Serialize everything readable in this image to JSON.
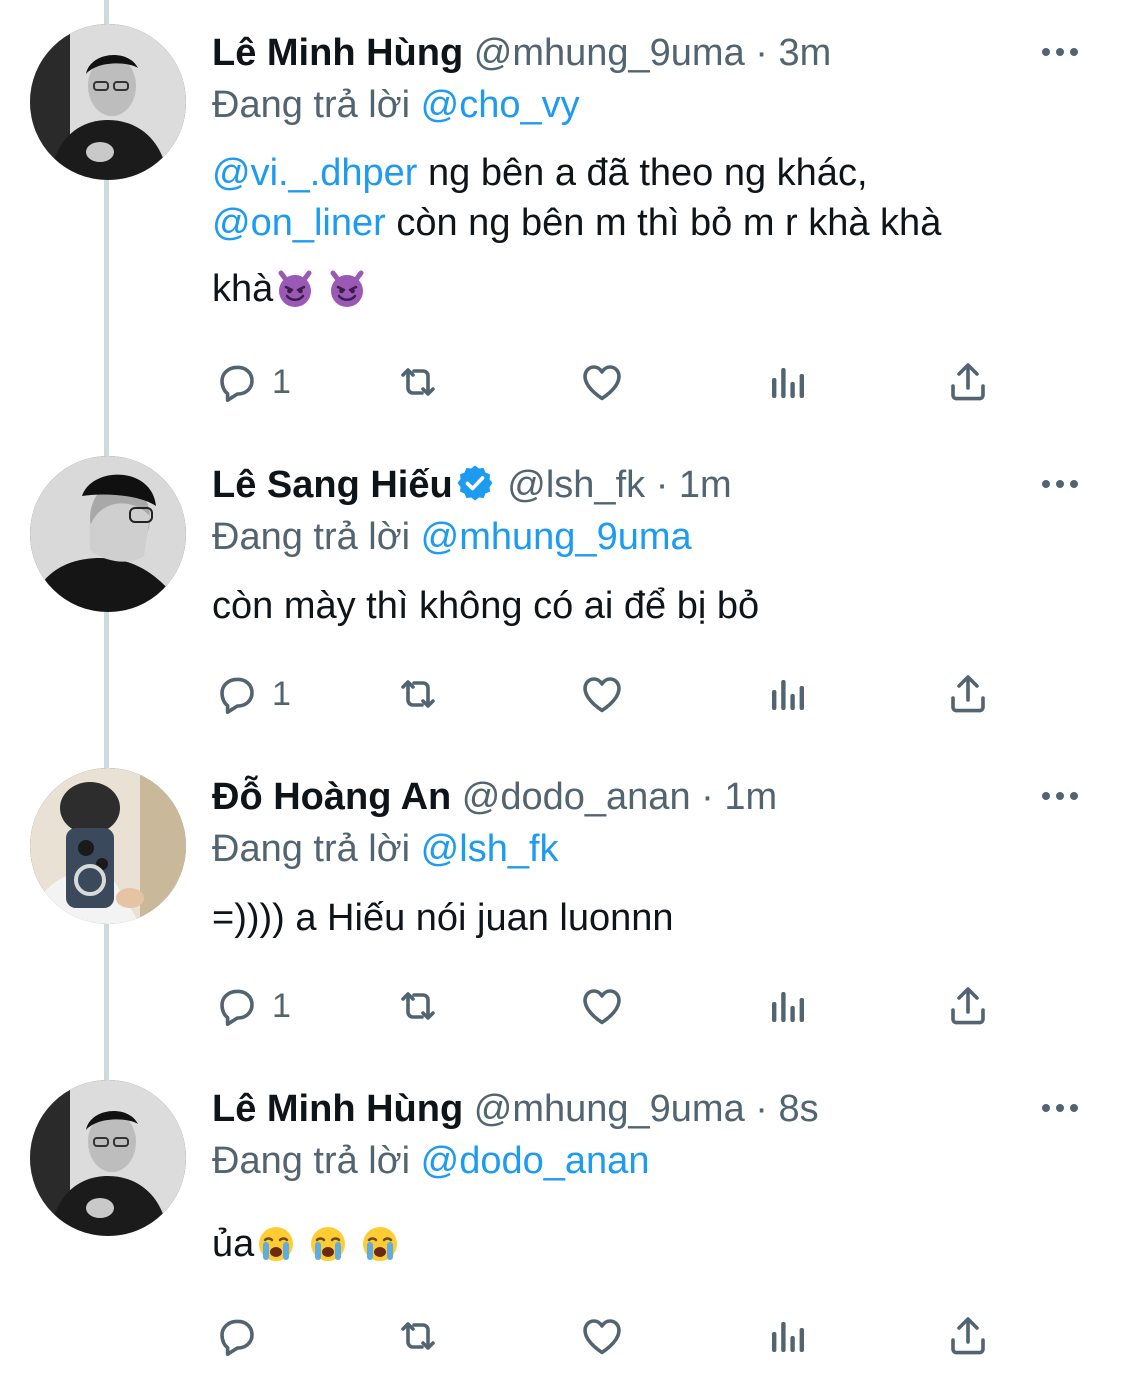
{
  "colors": {
    "accent": "#1d9bf0",
    "muted": "#536471",
    "text": "#0f1419",
    "thread_line": "#cfd9de"
  },
  "tweets": [
    {
      "name": "Lê Minh Hùng",
      "handle": "@mhung_9uma",
      "dot": "·",
      "time": "3m",
      "reply_prefix": "Đang trả lời",
      "reply_to": "@cho_vy",
      "mention_1": "@vi._.dhper",
      "text_1": "ng bên a đã theo ng khác,",
      "mention_2": "@on_liner",
      "text_2": "còn ng bên m thì bỏ m r khà khà",
      "text_3": "khà",
      "emojis": [
        "smiling-imp-emoji",
        "smiling-imp-emoji"
      ],
      "reply_count": "1"
    },
    {
      "name": "Lê Sang Hiếu",
      "verified": true,
      "handle": "@lsh_fk",
      "dot": "·",
      "time": "1m",
      "reply_prefix": "Đang trả lời",
      "reply_to": "@mhung_9uma",
      "text": "còn mày thì không có ai để bị bỏ",
      "reply_count": "1"
    },
    {
      "name": "Đỗ Hoàng An",
      "handle": "@dodo_anan",
      "dot": "·",
      "time": "1m",
      "reply_prefix": "Đang trả lời",
      "reply_to": "@lsh_fk",
      "text": "=)))) a Hiếu nói juan luonnn",
      "reply_count": "1"
    },
    {
      "name": "Lê Minh Hùng",
      "handle": "@mhung_9uma",
      "dot": "·",
      "time": "8s",
      "reply_prefix": "Đang trả lời",
      "reply_to": "@dodo_anan",
      "text": "ủa",
      "emojis": [
        "crying-emoji",
        "crying-emoji",
        "crying-emoji"
      ],
      "reply_count": ""
    }
  ],
  "icons": {
    "reply": "speech-bubble-icon",
    "retweet": "retweet-icon",
    "like": "heart-icon",
    "views": "bar-chart-icon",
    "share": "share-icon",
    "more": "more-dots-icon",
    "verified": "verified-badge-icon"
  }
}
